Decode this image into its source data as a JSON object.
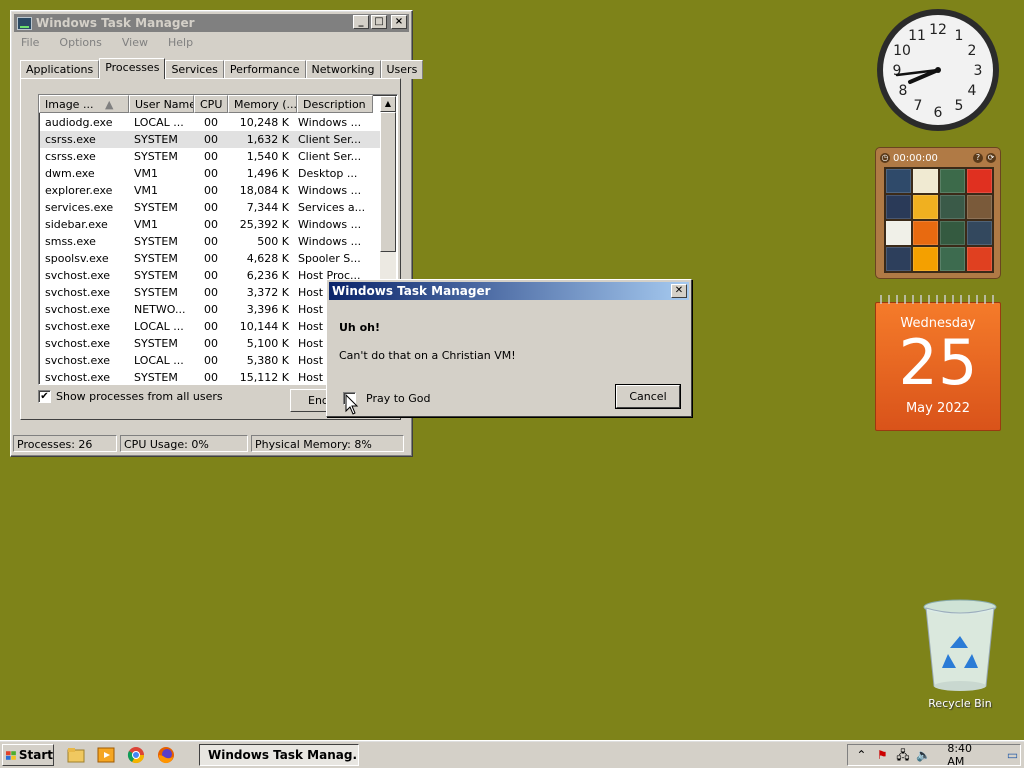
{
  "task_manager": {
    "title": "Windows Task Manager",
    "menu": [
      "File",
      "Options",
      "View",
      "Help"
    ],
    "tabs": [
      "Applications",
      "Processes",
      "Services",
      "Performance",
      "Networking",
      "Users"
    ],
    "active_tab": "Processes",
    "columns": [
      "Image ...",
      "User Name",
      "CPU",
      "Memory (...",
      "Description"
    ],
    "rows": [
      [
        "audiodg.exe",
        "LOCAL ...",
        "00",
        "10,248 K",
        "Windows ..."
      ],
      [
        "csrss.exe",
        "SYSTEM",
        "00",
        "1,632 K",
        "Client Ser..."
      ],
      [
        "csrss.exe",
        "SYSTEM",
        "00",
        "1,540 K",
        "Client Ser..."
      ],
      [
        "dwm.exe",
        "VM1",
        "00",
        "1,496 K",
        "Desktop ..."
      ],
      [
        "explorer.exe",
        "VM1",
        "00",
        "18,084 K",
        "Windows ..."
      ],
      [
        "services.exe",
        "SYSTEM",
        "00",
        "7,344 K",
        "Services a..."
      ],
      [
        "sidebar.exe",
        "VM1",
        "00",
        "25,392 K",
        "Windows ..."
      ],
      [
        "smss.exe",
        "SYSTEM",
        "00",
        "500 K",
        "Windows ..."
      ],
      [
        "spoolsv.exe",
        "SYSTEM",
        "00",
        "4,628 K",
        "Spooler S..."
      ],
      [
        "svchost.exe",
        "SYSTEM",
        "00",
        "6,236 K",
        "Host Proc..."
      ],
      [
        "svchost.exe",
        "SYSTEM",
        "00",
        "3,372 K",
        "Host"
      ],
      [
        "svchost.exe",
        "NETWO...",
        "00",
        "3,396 K",
        "Host"
      ],
      [
        "svchost.exe",
        "LOCAL ...",
        "00",
        "10,144 K",
        "Host"
      ],
      [
        "svchost.exe",
        "SYSTEM",
        "00",
        "5,100 K",
        "Host"
      ],
      [
        "svchost.exe",
        "LOCAL ...",
        "00",
        "5,380 K",
        "Host"
      ],
      [
        "svchost.exe",
        "SYSTEM",
        "00",
        "15,112 K",
        "Host"
      ]
    ],
    "show_all_label": "Show processes from all users",
    "show_all_checked": "✔",
    "end_button": "End",
    "status": {
      "processes": "Processes: 26",
      "cpu": "CPU Usage: 0%",
      "memory": "Physical Memory: 8%"
    }
  },
  "dialog": {
    "title": "Windows Task Manager",
    "heading": "Uh oh!",
    "message": "Can't do that on a Christian VM!",
    "checkbox_label": "Pray to God",
    "cancel": "Cancel"
  },
  "puzzle": {
    "timer": "00:00:00",
    "tiles": [
      "#2f4a6a",
      "#f0ead2",
      "#3c6a4a",
      "#e03020",
      "#2a3a58",
      "#f0b020",
      "#3a5a48",
      "#7a5a3a",
      "#f0f0e8",
      "#e86a10",
      "#345a40",
      "#33485e",
      "#2d3f5c",
      "#f4a000",
      "#3d6b4f",
      "#e04020"
    ]
  },
  "calendar": {
    "weekday": "Wednesday",
    "day": "25",
    "month_year": "May 2022"
  },
  "recycle_bin": {
    "label": "Recycle Bin"
  },
  "taskbar": {
    "start": "Start",
    "task_button": "Windows Task Manag...",
    "time": "8:40 AM"
  },
  "colors": {
    "desktop": "#7e8319",
    "dialog_title_start": "#0a246a",
    "dialog_title_end": "#a6caf0",
    "calendar": "#f57b2a"
  }
}
